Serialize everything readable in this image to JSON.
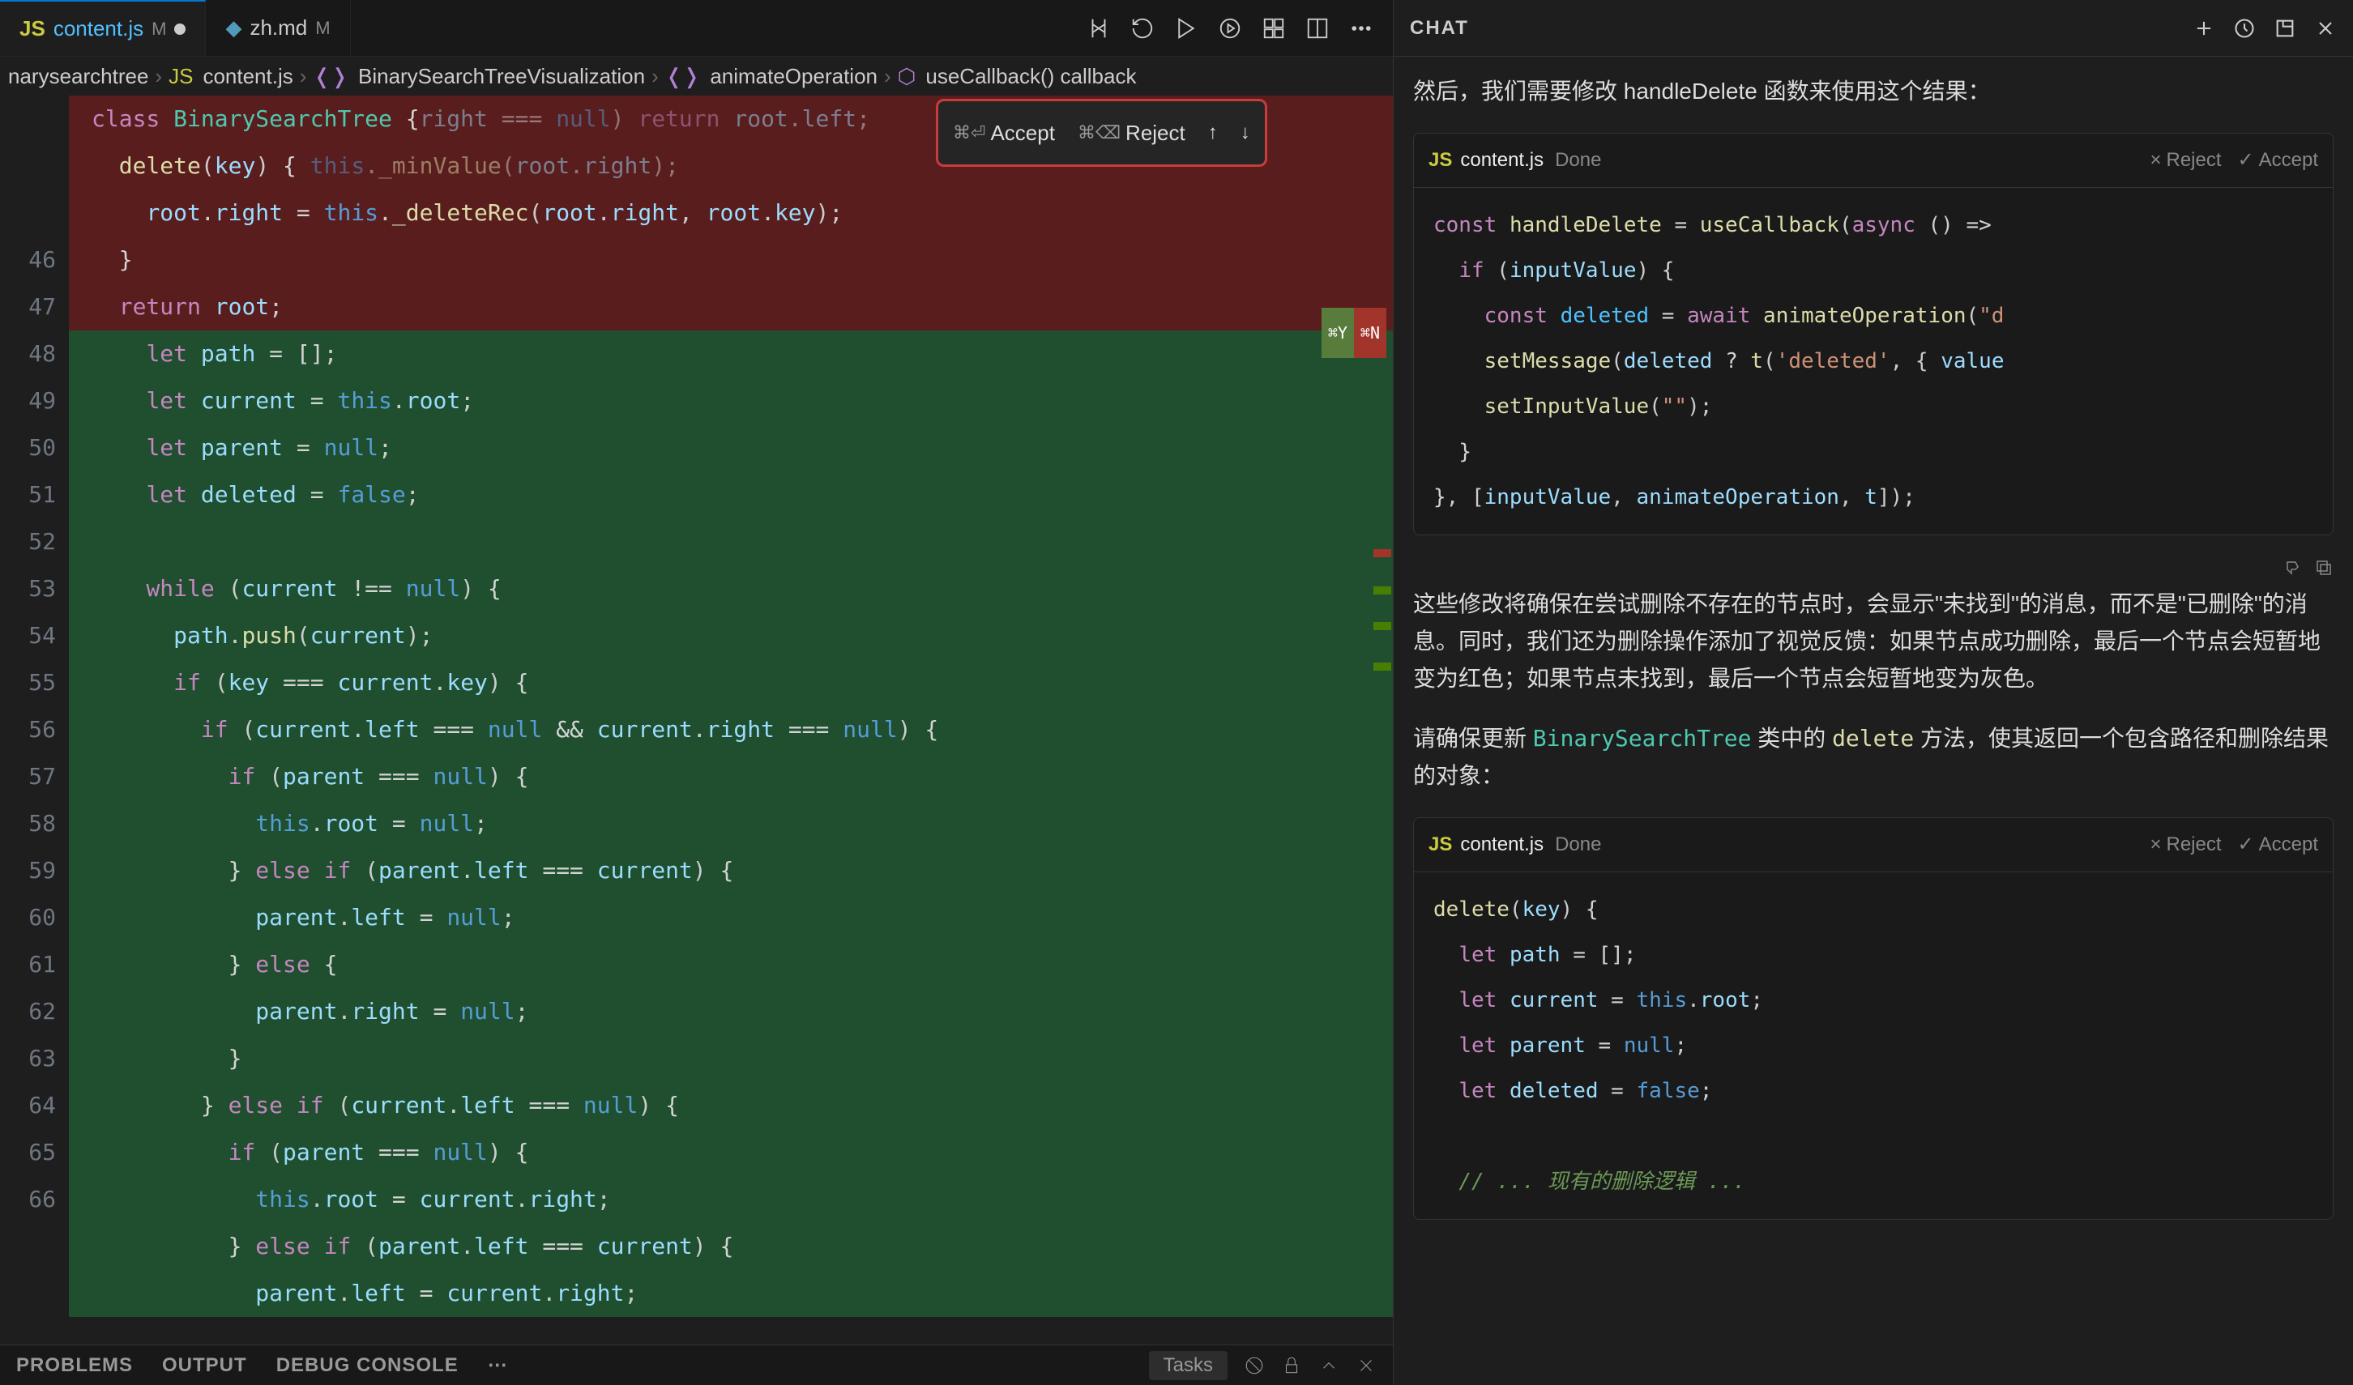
{
  "tabs": [
    {
      "icon": "JS",
      "name": "content.js",
      "modifier": "M",
      "dirty": true,
      "active": true
    },
    {
      "icon": "↓",
      "name": "zh.md",
      "modifier": "M",
      "dirty": false,
      "active": false
    }
  ],
  "breadcrumb": {
    "items": [
      "narysearchtree",
      "content.js",
      "BinarySearchTreeVisualization",
      "animateOperation",
      "useCallback() callback"
    ]
  },
  "accept_reject": {
    "accept_key": "⌘⏎",
    "accept_label": "Accept",
    "reject_key": "⌘⌫",
    "reject_label": "Reject",
    "up": "↑",
    "down": "↓"
  },
  "inline_badges": {
    "y": "⌘Y",
    "n": "⌘N"
  },
  "line_numbers": [
    "46",
    "47",
    "48",
    "49",
    "50",
    "51",
    "52",
    "53",
    "54",
    "55",
    "56",
    "57",
    "58",
    "59",
    "60",
    "61",
    "62",
    "63",
    "64",
    "65",
    "66"
  ],
  "bottom_panel": {
    "tabs": [
      "PROBLEMS",
      "OUTPUT",
      "DEBUG CONSOLE",
      "⋯"
    ],
    "tasks": "Tasks"
  },
  "chat": {
    "title": "CHAT",
    "intro": "然后，我们需要修改 handleDelete 函数来使用这个结果：",
    "code_blocks": [
      {
        "file": "content.js",
        "status": "Done",
        "reject": "Reject",
        "accept": "Accept"
      },
      {
        "file": "content.js",
        "status": "Done",
        "reject": "Reject",
        "accept": "Accept"
      }
    ],
    "paragraph1": "这些修改将确保在尝试删除不存在的节点时，会显示\"未找到\"的消息，而不是\"已删除\"的消息。同时，我们还为删除操作添加了视觉反馈：如果节点成功删除，最后一个节点会短暂地变为红色；如果节点未找到，最后一个节点会短暂地变为灰色。",
    "paragraph2_pre": "请确保更新 ",
    "paragraph2_cls": "BinarySearchTree",
    "paragraph2_mid": " 类中的 ",
    "paragraph2_fn": "delete",
    "paragraph2_post": " 方法，使其返回一个包含路径和删除结果的对象："
  },
  "code_content": {
    "overlap": [
      "class BinarySearchTree {",
      "  delete(key) {"
    ],
    "deleted_lines": [
      "    else if (root.right === null) return root.left;",
      "    root.key = this._minValue(root.right);",
      "    root.right = this._deleteRec(root.right, root.key);",
      "  }",
      "  return root;"
    ],
    "added_lines": [
      {
        "n": "46",
        "t": "    let path = [];"
      },
      {
        "n": "47",
        "t": "    let current = this.root;"
      },
      {
        "n": "48",
        "t": "    let parent = null;"
      },
      {
        "n": "49",
        "t": "    let deleted = false;"
      },
      {
        "n": "50",
        "t": ""
      },
      {
        "n": "51",
        "t": "    while (current !== null) {"
      },
      {
        "n": "52",
        "t": "      path.push(current);"
      },
      {
        "n": "53",
        "t": "      if (key === current.key) {"
      },
      {
        "n": "54",
        "t": "        if (current.left === null && current.right === null) {"
      },
      {
        "n": "55",
        "t": "          if (parent === null) {"
      },
      {
        "n": "56",
        "t": "            this.root = null;"
      },
      {
        "n": "57",
        "t": "          } else if (parent.left === current) {"
      },
      {
        "n": "58",
        "t": "            parent.left = null;"
      },
      {
        "n": "59",
        "t": "          } else {"
      },
      {
        "n": "60",
        "t": "            parent.right = null;"
      },
      {
        "n": "61",
        "t": "          }"
      },
      {
        "n": "62",
        "t": "        } else if (current.left === null) {"
      },
      {
        "n": "63",
        "t": "          if (parent === null) {"
      },
      {
        "n": "64",
        "t": "            this.root = current.right;"
      },
      {
        "n": "65",
        "t": "          } else if (parent.left === current) {"
      },
      {
        "n": "66",
        "t": "            parent.left = current.right;"
      }
    ]
  },
  "chat_code1_lines": [
    "const handleDelete = useCallback(async () =>",
    "  if (inputValue) {",
    "    const deleted = await animateOperation(\"d",
    "    setMessage(deleted ? t('deleted', { value",
    "    setInputValue(\"\");",
    "  }",
    "}, [inputValue, animateOperation, t]);"
  ],
  "chat_code2_lines": [
    "delete(key) {",
    "  let path = [];",
    "  let current = this.root;",
    "  let parent = null;",
    "  let deleted = false;",
    "",
    "  // ... 现有的删除逻辑 ..."
  ]
}
